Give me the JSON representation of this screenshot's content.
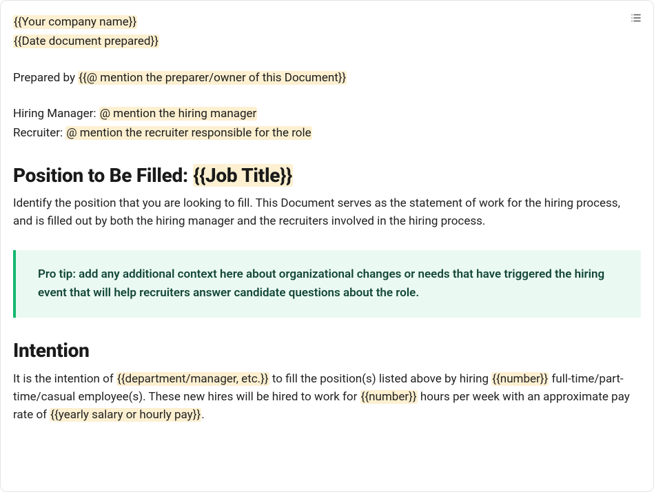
{
  "header": {
    "company_placeholder": "{{Your company name}}",
    "date_placeholder": "{{Date document prepared}}",
    "prepared_by_label": "Prepared by ",
    "prepared_by_placeholder": "{{@ mention the preparer/owner of this Document}}",
    "hiring_manager_label": "Hiring Manager: ",
    "hiring_manager_placeholder": "@ mention the hiring manager",
    "recruiter_label": "Recruiter: ",
    "recruiter_placeholder": "@ mention the recruiter responsible for the role"
  },
  "position": {
    "heading_prefix": "Position to Be Filled: ",
    "heading_placeholder": "{{Job Title}}",
    "body": "Identify the position that you are looking to fill. This Document serves as the statement of work for the hiring process, and is filled out by both the hiring manager and the recruiters involved in the hiring process."
  },
  "callout": {
    "text": "Pro tip: add any additional context here about organizational changes or needs that have triggered the hiring event that will help recruiters answer candidate questions about the role."
  },
  "intention": {
    "heading": "Intention",
    "body_1a": "It is the intention of ",
    "ph_dept": "{{department/manager, etc.}}",
    "body_1b": " to fill the position(s) listed above by hiring ",
    "ph_num1": "{{number}}",
    "body_2a": " full-time/part-time/casual employee(s). These new hires will be hired to work for ",
    "ph_num2": "{{number}}",
    "body_2b": " hours per week with an approximate pay rate of ",
    "ph_pay": "{{yearly salary or hourly pay}}",
    "body_end": "."
  }
}
